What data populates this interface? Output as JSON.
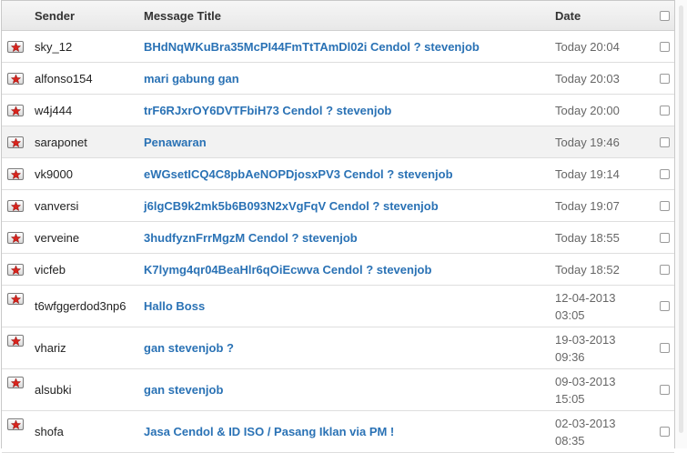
{
  "header": {
    "sender": "Sender",
    "title": "Message Title",
    "date": "Date"
  },
  "messages": [
    {
      "sender": "sky_12",
      "title": "BHdNqWKuBra35McPI44FmTtTAmDl02i Cendol ? stevenjob",
      "date_line1": "Today 20:04",
      "date_line2": ""
    },
    {
      "sender": "alfonso154",
      "title": "mari gabung gan",
      "date_line1": "Today 20:03",
      "date_line2": ""
    },
    {
      "sender": "w4j444",
      "title": "trF6RJxrOY6DVTFbiH73 Cendol ? stevenjob",
      "date_line1": "Today 20:00",
      "date_line2": ""
    },
    {
      "sender": "saraponet",
      "title": "Penawaran",
      "date_line1": "Today 19:46",
      "date_line2": ""
    },
    {
      "sender": "vk9000",
      "title": "eWGsetICQ4C8pbAeNOPDjosxPV3 Cendol ? stevenjob",
      "date_line1": "Today 19:14",
      "date_line2": ""
    },
    {
      "sender": "vanversi",
      "title": "j6lgCB9k2mk5b6B093N2xVgFqV Cendol ? stevenjob",
      "date_line1": "Today 19:07",
      "date_line2": ""
    },
    {
      "sender": "verveine",
      "title": "3hudfyznFrrMgzM Cendol ? stevenjob",
      "date_line1": "Today 18:55",
      "date_line2": ""
    },
    {
      "sender": "vicfeb",
      "title": "K7lymg4qr04BeaHlr6qOiEcwva Cendol ? stevenjob",
      "date_line1": "Today 18:52",
      "date_line2": ""
    },
    {
      "sender": "t6wfggerdod3np6",
      "title": "Hallo Boss",
      "date_line1": "12-04-2013",
      "date_line2": "03:05"
    },
    {
      "sender": "vhariz",
      "title": "gan stevenjob ?",
      "date_line1": "19-03-2013",
      "date_line2": "09:36"
    },
    {
      "sender": "alsubki",
      "title": "gan stevenjob",
      "date_line1": "09-03-2013",
      "date_line2": "15:05"
    },
    {
      "sender": "shofa",
      "title": "Jasa Cendol & ID ISO / Pasang Iklan via PM !",
      "date_line1": "02-03-2013",
      "date_line2": "08:35"
    }
  ],
  "icons": {
    "message": "mail-star-icon",
    "select": "checkbox"
  },
  "colors": {
    "title_link": "#2a72b5",
    "star": "#d9241c",
    "alt_row": "#f2f2f2"
  }
}
